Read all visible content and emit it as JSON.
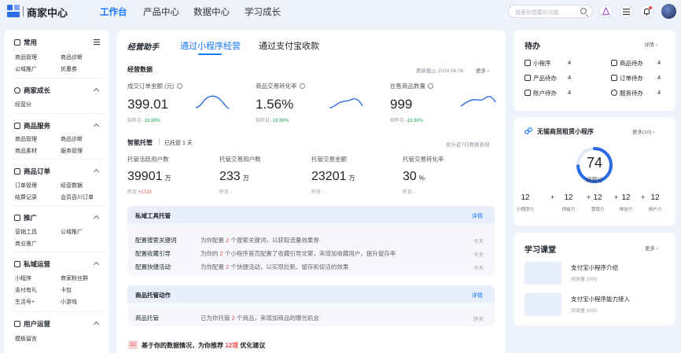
{
  "topbar": {
    "brand": "商家中心",
    "nav": [
      "工作台",
      "产品中心",
      "数据中心",
      "学习成长"
    ],
    "search_placeholder": "搜索你想要的功能"
  },
  "sidebar": {
    "groups": [
      {
        "title": "常用",
        "items": [
          "商品管理",
          "商品诊断",
          "公域推广",
          "优惠券"
        ]
      },
      {
        "title": "商家成长",
        "items": [
          "经营分"
        ]
      },
      {
        "title": "商品服务",
        "items": [
          "商品管理",
          "商品诊断",
          "商品素材",
          "服务管理"
        ]
      },
      {
        "title": "商品订单",
        "items": [
          "订单管理",
          "经营数据",
          "结算记录",
          "会员百川订单"
        ]
      },
      {
        "title": "推广",
        "items": [
          "营销工具",
          "公域推广",
          "商业推广"
        ]
      },
      {
        "title": "私域运营",
        "items": [
          "小程序",
          "商家粉丝群",
          "支付有礼",
          "卡包",
          "生活号+",
          "小游戏"
        ]
      },
      {
        "title": "用户运营",
        "items": [
          "模板留言"
        ]
      }
    ]
  },
  "main": {
    "assistant": "经营助手",
    "tabs": [
      "通过小程序经营",
      "通过支付宝收款"
    ],
    "biz": {
      "title": "经营数据",
      "updated": "更新截止 2024 06 06",
      "more": "更多",
      "kpis": [
        {
          "label": "成交订单金额 (元)",
          "value": "399.01",
          "prev": "较昨日",
          "change": "-19.98%"
        },
        {
          "label": "商品交易转化率",
          "value": "1.56%",
          "prev": "较昨日",
          "change": "-19.98%"
        },
        {
          "label": "在售商品数量",
          "value": "999",
          "prev": "较昨日",
          "change": "-19.98%"
        }
      ]
    },
    "hosting": {
      "title": "智能托管",
      "days": "已托管 1 天",
      "note": "统计近7日数据表现",
      "metrics": [
        {
          "label": "托管活跃用户数",
          "value": "39901",
          "unit": "万",
          "sub": "昨日",
          "delta": "+1723"
        },
        {
          "label": "托管交易用户数",
          "value": "233",
          "unit": "万",
          "sub": "昨日",
          "delta": "-"
        },
        {
          "label": "托管交易金额",
          "value": "23201",
          "unit": "万",
          "sub": "昨日",
          "delta": "-"
        },
        {
          "label": "托管交易转化率",
          "value": "30",
          "unit": "%",
          "sub": "昨日",
          "delta": "-"
        }
      ]
    },
    "tools": {
      "title": "私域工具托管",
      "detail": "详情",
      "rows": [
        {
          "name": "配置搜索关键词",
          "pre": "为你配置",
          "num": "2",
          "post": "个搜索关键词，以获取流量效果券",
          "time": "今天"
        },
        {
          "name": "配置收藏引导",
          "pre": "为你的",
          "num": "2",
          "post": "个小程序首页配置了收藏引导文案，来增加收藏用户，提升留存率",
          "time": "今天"
        },
        {
          "name": "配置快捷活动",
          "pre": "为你配置",
          "num": "2",
          "post": "个快捷活动，以实现拉新、留存和促活的效果",
          "time": "今天"
        }
      ]
    },
    "goods": {
      "title": "商品托管动作",
      "detail": "详情",
      "rows": [
        {
          "name": "商品托管",
          "pre": "已为你托管",
          "num": "2",
          "post": "个商品，来增加商品的曝光机会",
          "time": "昨天"
        }
      ]
    },
    "suggest": {
      "badge": "12",
      "pre": "基于你的数据情况，为你推荐",
      "num": "12项",
      "post": "优化建议"
    }
  },
  "todo": {
    "title": "待办",
    "detail": "详情",
    "items": [
      {
        "label": "小程序",
        "count": "4"
      },
      {
        "label": "商品待办",
        "count": "4"
      },
      {
        "label": "产品待办",
        "count": "4"
      },
      {
        "label": "订单待办",
        "count": "4"
      },
      {
        "label": "账户待办",
        "count": "4"
      },
      {
        "label": "服务待办",
        "count": "4"
      }
    ]
  },
  "mini": {
    "title": "无锡商贸租赁小程序",
    "more": "更多(10)",
    "score": "74",
    "score_label": "经营分",
    "score_fraction": 0.74,
    "parts": [
      {
        "value": "12",
        "label": "小程序力"
      },
      {
        "value": "12",
        "label": "供给力"
      },
      {
        "value": "12",
        "label": "营销力"
      },
      {
        "value": "12",
        "label": "体验力"
      },
      {
        "value": "12",
        "label": "用户力"
      }
    ]
  },
  "learn": {
    "title": "学习课堂",
    "more": "更多",
    "courses": [
      {
        "title": "支付宝小程序介绍",
        "sub": "阅读量 1000"
      },
      {
        "title": "支付宝小程序能力接入",
        "sub": "阅读量 1000"
      }
    ]
  },
  "colors": {
    "accent": "#1677ff",
    "up": "#1aa65a",
    "down": "#e84a4a"
  }
}
